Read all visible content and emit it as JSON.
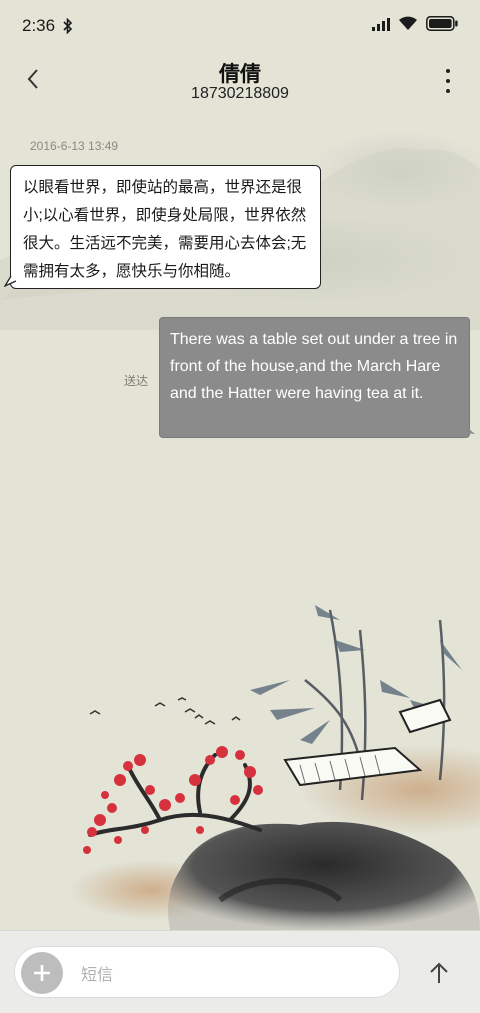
{
  "status_bar": {
    "time": "2:36",
    "battery_color": "#1b1b1b"
  },
  "header": {
    "contact_name": "倩倩",
    "contact_number": "18730218809"
  },
  "conversation": {
    "timestamp": "2016-6-13 13:49",
    "incoming_message": "以眼看世界，即使站的最高，世界还是很小;以心看世界，即使身处局限，世界依然很大。生活远不完美，需要用心去体会;无需拥有太多，愿快乐与你相随。",
    "outgoing_message": "There was a table set out under a tree in front of the house,and the March Hare and the Hatter were having tea at it.",
    "outgoing_status": "送达"
  },
  "composer": {
    "placeholder": "短信"
  },
  "icons": {
    "back": "chevron-left-icon",
    "more": "more-vertical-icon",
    "add": "plus-icon",
    "send": "arrow-up-icon",
    "bluetooth": "bluetooth-icon",
    "signal": "signal-icon",
    "wifi": "wifi-icon",
    "battery": "battery-icon"
  },
  "colors": {
    "background": "#e3e3d6",
    "outgoing_bubble": "#8b8b8b",
    "incoming_bubble": "#ffffff",
    "plum_blossom": "#d6323e"
  }
}
